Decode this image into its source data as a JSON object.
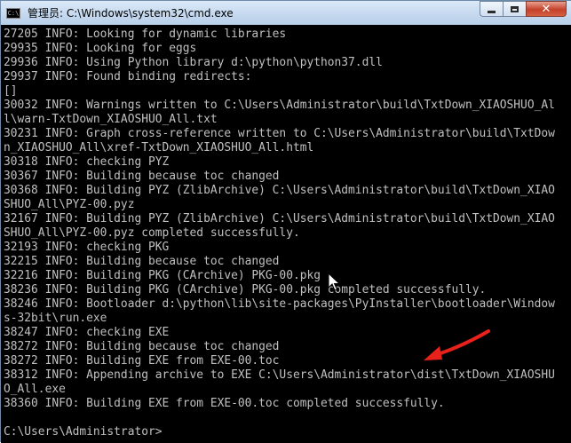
{
  "window": {
    "title": "管理员: C:\\Windows\\system32\\cmd.exe",
    "icon_label": "C:\\",
    "controls": {
      "close_glyph": "✕"
    }
  },
  "console": {
    "lines": [
      "27205 INFO: Looking for dynamic libraries",
      "29935 INFO: Looking for eggs",
      "29936 INFO: Using Python library d:\\python\\python37.dll",
      "29937 INFO: Found binding redirects:",
      "[]",
      "30032 INFO: Warnings written to C:\\Users\\Administrator\\build\\TxtDown_XIAOSHUO_Al",
      "l\\warn-TxtDown_XIAOSHUO_All.txt",
      "30231 INFO: Graph cross-reference written to C:\\Users\\Administrator\\build\\TxtDow",
      "n_XIAOSHUO_All\\xref-TxtDown_XIAOSHUO_All.html",
      "30318 INFO: checking PYZ",
      "30367 INFO: Building because toc changed",
      "30368 INFO: Building PYZ (ZlibArchive) C:\\Users\\Administrator\\build\\TxtDown_XIAO",
      "SHUO_All\\PYZ-00.pyz",
      "32167 INFO: Building PYZ (ZlibArchive) C:\\Users\\Administrator\\build\\TxtDown_XIAO",
      "SHUO_All\\PYZ-00.pyz completed successfully.",
      "32193 INFO: checking PKG",
      "32215 INFO: Building because toc changed",
      "32216 INFO: Building PKG (CArchive) PKG-00.pkg",
      "38236 INFO: Building PKG (CArchive) PKG-00.pkg completed successfully.",
      "38246 INFO: Bootloader d:\\python\\lib\\site-packages\\PyInstaller\\bootloader\\Window",
      "s-32bit\\run.exe",
      "38247 INFO: checking EXE",
      "38272 INFO: Building because toc changed",
      "38272 INFO: Building EXE from EXE-00.toc",
      "38312 INFO: Appending archive to EXE C:\\Users\\Administrator\\dist\\TxtDown_XIAOSHU",
      "O_All.exe",
      "38360 INFO: Building EXE from EXE-00.toc completed successfully.",
      "",
      "C:\\Users\\Administrator>"
    ]
  },
  "colors": {
    "console_bg": "#000000",
    "console_text": "#c0c0c0",
    "arrow": "#e8211b",
    "close_button": "#c4412a"
  },
  "overlays": {
    "mouse_cursor": "arrow-pointer",
    "annotation": "red-arrow"
  }
}
